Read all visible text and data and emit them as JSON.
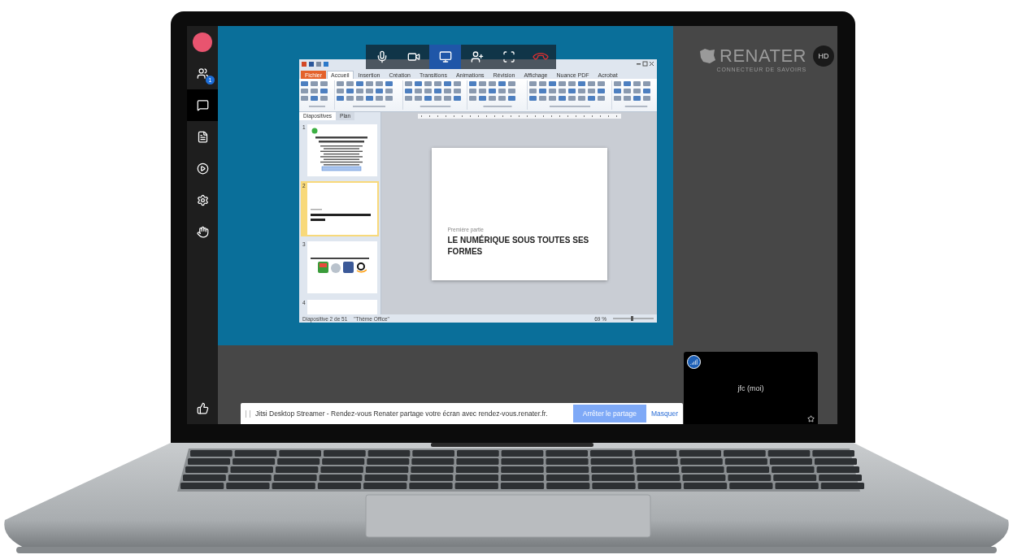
{
  "sidebar": {
    "items": [
      {
        "kind": "avatar",
        "selected": false
      },
      {
        "kind": "participants",
        "badge": "1",
        "selected": false
      },
      {
        "kind": "chat",
        "selected": true
      },
      {
        "kind": "document",
        "selected": false
      },
      {
        "kind": "video",
        "selected": false
      },
      {
        "kind": "settings",
        "selected": false
      },
      {
        "kind": "hand",
        "selected": false
      }
    ],
    "bottom": [
      {
        "kind": "like",
        "selected": false
      }
    ]
  },
  "toolbar": {
    "buttons": [
      {
        "kind": "mic",
        "selected": false
      },
      {
        "kind": "camera",
        "selected": false
      },
      {
        "kind": "share",
        "selected": true
      },
      {
        "kind": "invite",
        "selected": false
      },
      {
        "kind": "fullscreen",
        "selected": false
      },
      {
        "kind": "hangup",
        "selected": false
      }
    ]
  },
  "shared_screen": {
    "ribbon_tabs": [
      {
        "label": "Fichier",
        "kind": "file",
        "selected": false
      },
      {
        "label": "Accueil",
        "kind": "tab",
        "selected": true
      },
      {
        "label": "Insertion",
        "kind": "tab",
        "selected": false
      },
      {
        "label": "Création",
        "kind": "tab",
        "selected": false
      },
      {
        "label": "Transitions",
        "kind": "tab",
        "selected": false
      },
      {
        "label": "Animations",
        "kind": "tab",
        "selected": false
      },
      {
        "label": "Révision",
        "kind": "tab",
        "selected": false
      },
      {
        "label": "Affichage",
        "kind": "tab",
        "selected": false
      },
      {
        "label": "Nuance PDF",
        "kind": "tab",
        "selected": false
      },
      {
        "label": "Acrobat",
        "kind": "tab",
        "selected": false
      }
    ],
    "panel_tabs": [
      {
        "label": "Diapositives",
        "selected": true
      },
      {
        "label": "Plan",
        "selected": false
      }
    ],
    "thumbnails": [
      {
        "number": "1",
        "kind": "title",
        "selected": false
      },
      {
        "number": "2",
        "kind": "section",
        "selected": true
      },
      {
        "number": "3",
        "kind": "logos",
        "selected": false
      },
      {
        "number": "4",
        "kind": "blank",
        "selected": false
      }
    ],
    "slide": {
      "subtitle": "Première partie",
      "title": "LE NUMÉRIQUE SOUS TOUTES SES FORMES"
    },
    "status_bar": {
      "position": "Diapositive 2 de 51",
      "theme": "\"Thème Office\"",
      "zoom": "69 %"
    }
  },
  "logo": {
    "name": "RENATER",
    "tagline": "CONNECTEUR DE SAVOIRS"
  },
  "hd_badge": "HD",
  "local_video": {
    "name": "jfc (moi)"
  },
  "notification": {
    "text": "Jitsi Desktop Streamer - Rendez-vous Renater partage votre écran avec rendez-vous.renater.fr.",
    "button": "Arrêter le partage",
    "link": "Masquer"
  }
}
